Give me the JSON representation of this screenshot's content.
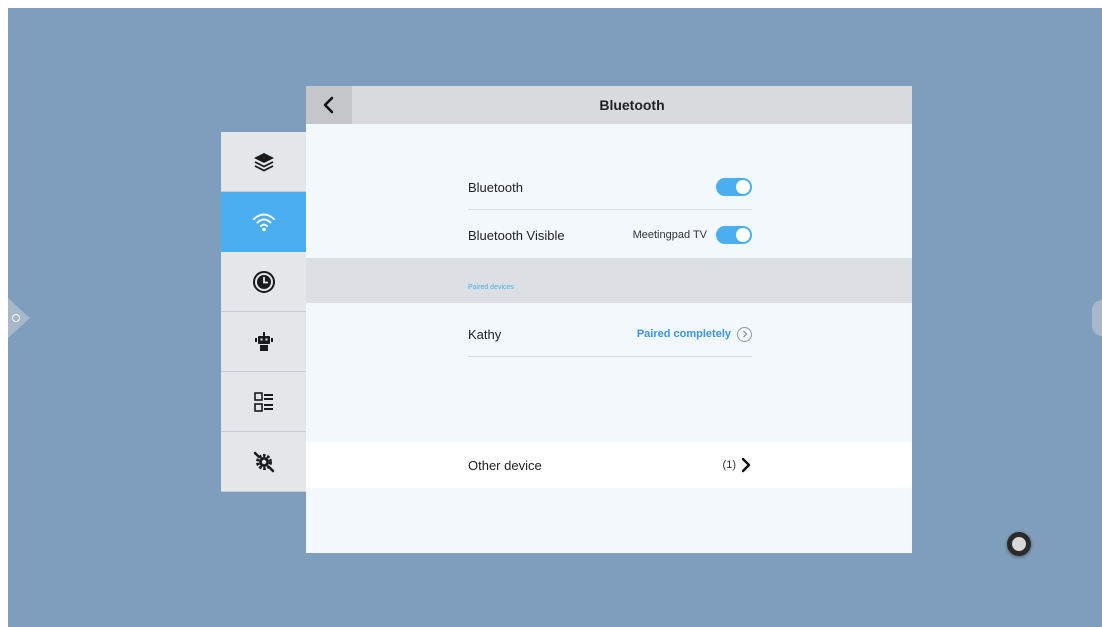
{
  "header": {
    "title": "Bluetooth"
  },
  "sidebar": {
    "items": [
      {
        "icon": "layers-icon",
        "active": false
      },
      {
        "icon": "wifi-icon",
        "active": true
      },
      {
        "icon": "clock-icon",
        "active": false
      },
      {
        "icon": "robot-icon",
        "active": false
      },
      {
        "icon": "list-icon",
        "active": false
      },
      {
        "icon": "gear-wrench-icon",
        "active": false
      }
    ]
  },
  "settings": {
    "bluetooth": {
      "label": "Bluetooth",
      "enabled": true
    },
    "visible": {
      "label": "Bluetooth Visible",
      "device_name": "Meetingpad TV",
      "enabled": true
    }
  },
  "paired": {
    "section_label": "Paired devices",
    "devices": [
      {
        "name": "Kathy",
        "status": "Paired completely"
      }
    ]
  },
  "other": {
    "label": "Other device",
    "count": "(1)"
  },
  "colors": {
    "accent": "#4aaef0",
    "screen_bg": "#7f9dbc",
    "panel_bg": "#f2f8fc"
  }
}
